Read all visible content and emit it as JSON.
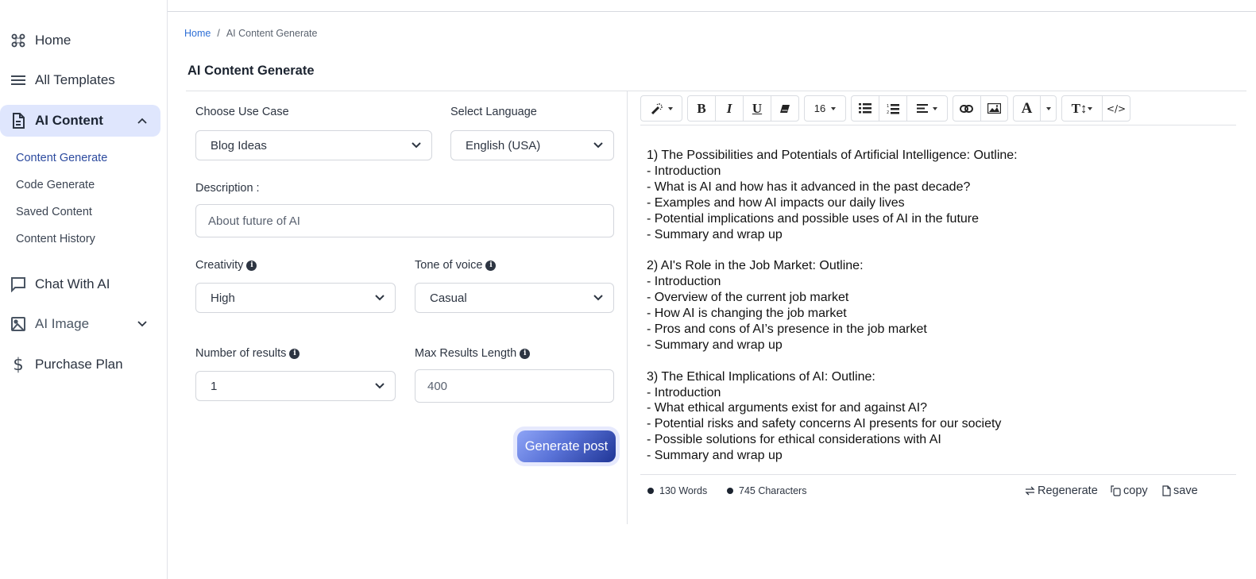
{
  "sidebar": {
    "items": [
      {
        "label": "Home",
        "icon": "command-icon"
      },
      {
        "label": "All Templates",
        "icon": "menu-icon"
      },
      {
        "label": "AI Content",
        "icon": "document-icon",
        "expanded": true
      },
      {
        "label": "Chat With AI",
        "icon": "chat-icon"
      },
      {
        "label": "AI Image",
        "icon": "image-icon",
        "expanded": false
      },
      {
        "label": "Purchase Plan",
        "icon": "dollar-icon"
      }
    ],
    "sub_items": [
      {
        "label": "Content Generate",
        "active": true
      },
      {
        "label": "Code Generate"
      },
      {
        "label": "Saved Content"
      },
      {
        "label": "Content History"
      }
    ]
  },
  "breadcrumb": {
    "home": "Home",
    "separator": "/",
    "current": "AI Content Generate"
  },
  "page": {
    "title": "AI Content Generate"
  },
  "form": {
    "use_case": {
      "label": "Choose Use Case",
      "value": "Blog Ideas"
    },
    "language": {
      "label": "Select Language",
      "value": "English (USA)"
    },
    "description": {
      "label": "Description :",
      "value": "About future of AI"
    },
    "creativity": {
      "label": "Creativity",
      "value": "High"
    },
    "tone": {
      "label": "Tone of voice",
      "value": "Casual"
    },
    "num_results": {
      "label": "Number of results",
      "value": "1"
    },
    "max_length": {
      "label": "Max Results Length",
      "value": "400"
    },
    "generate_label": "Generate post"
  },
  "colors": {
    "accent": "#2c4a9e",
    "active_bg": "#dfe6fd",
    "button_start": "#8ea4f6",
    "button_end": "#1f3596"
  },
  "editor": {
    "toolbar": {
      "font_size": "16",
      "buttons": [
        "magic-wand",
        "bold",
        "italic",
        "underline",
        "eraser",
        "font-size",
        "unordered-list",
        "ordered-list",
        "align",
        "link",
        "image",
        "font-color",
        "line-height",
        "code-view"
      ]
    },
    "paragraphs": [
      [
        "1) The Possibilities and Potentials of Artificial Intelligence: Outline:",
        "- Introduction",
        "- What is AI and how has it advanced in the past decade?",
        "- Examples and how AI impacts our daily lives",
        "- Potential implications and possible uses of AI in the future",
        "- Summary and wrap up"
      ],
      [
        "2) AI's Role in the Job Market: Outline:",
        "- Introduction",
        "- Overview of the current job market",
        "- How AI is changing the job market",
        "- Pros and cons of AI’s presence in the job market",
        "- Summary and wrap up"
      ],
      [
        "3) The Ethical Implications of AI: Outline:",
        "- Introduction",
        "- What ethical arguments exist for and against AI?",
        "- Potential risks and safety concerns AI presents for our society",
        "- Possible solutions for ethical considerations with AI",
        "- Summary and wrap up"
      ]
    ],
    "stats": {
      "words": "130 Words",
      "characters": "745 Characters"
    },
    "actions": {
      "regenerate": "Regenerate",
      "copy": "copy",
      "save": "save"
    }
  }
}
